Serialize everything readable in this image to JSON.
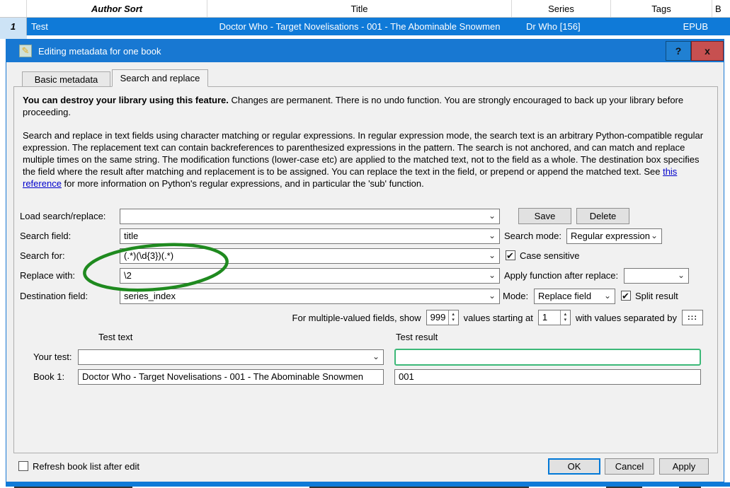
{
  "book_table": {
    "columns": [
      {
        "label": ""
      },
      {
        "label": "Author Sort"
      },
      {
        "label": "Title"
      },
      {
        "label": "Series"
      },
      {
        "label": "Tags"
      },
      {
        "label": "B"
      }
    ],
    "row": {
      "num": "1",
      "author_sort": "Test",
      "title": "Doctor Who - Target Novelisations - 001 - The Abominable Snowmen",
      "series": "Dr Who [156]",
      "format": "EPUB"
    }
  },
  "dialog": {
    "title": "Editing metadata for one book",
    "icons": {
      "pencil": "✎",
      "help": "?",
      "close": "x",
      "chevron": "⌄",
      "check": "✔",
      "spin_up": "▴",
      "spin_down": "▾"
    },
    "tabs": [
      {
        "label": "Basic metadata"
      },
      {
        "label": "Search and replace"
      }
    ],
    "warning_bold": "You can destroy your library using this feature.",
    "warning_rest": " Changes are permanent. There is no undo function. You are strongly encouraged to back up your library before proceeding.",
    "desc_part1": "Search and replace in text fields using character matching or regular expressions. In regular expression mode, the search text is an arbitrary Python-compatible regular expression. The replacement text can contain backreferences to parenthesized expressions in the pattern. The search is not anchored, and can match and replace multiple times on the same string. The modification functions (lower-case etc) are applied to the matched text, not to the field as a whole. The destination box specifies the field where the result after matching and replacement is to be assigned. You can replace the text in the field, or prepend or append the matched text. See ",
    "link_text": "this reference",
    "desc_part2": " for more information on Python's regular expressions, and in particular the 'sub' function.",
    "form": {
      "load_label": "Load search/replace:",
      "load_value": "",
      "save_button": "Save",
      "delete_button": "Delete",
      "search_field_label": "Search field:",
      "search_field_value": "title",
      "search_mode_label": "Search mode:",
      "search_mode_value": "Regular expression",
      "search_for_label": "Search for:",
      "search_for_value": "(.*)(\\d{3})(.*)",
      "case_sensitive_label": "Case sensitive",
      "case_sensitive_checked": true,
      "replace_with_label": "Replace with:",
      "replace_with_value": "\\2",
      "apply_function_label": "Apply function after replace:",
      "apply_function_value": "",
      "destination_label": "Destination field:",
      "destination_value": "series_index",
      "mode_label": "Mode:",
      "mode_value": "Replace field",
      "split_result_label": "Split result",
      "split_result_checked": true,
      "multi_text1": "For multiple-valued fields, show",
      "multi_show_value": "999",
      "multi_text2": "values starting at",
      "multi_start_value": "1",
      "multi_text3": "with values separated by",
      "separator_value": ":::"
    },
    "test": {
      "text_header": "Test text",
      "result_header": "Test result",
      "your_test_label": "Your test:",
      "your_test_value": "",
      "your_test_result": "",
      "book1_label": "Book 1:",
      "book1_value": "Doctor Who - Target Novelisations - 001 - The Abominable Snowmen",
      "book1_result": "001"
    },
    "footer": {
      "refresh_label": "Refresh book list after edit",
      "refresh_checked": false,
      "ok_button": "OK",
      "cancel_button": "Cancel",
      "apply_button": "Apply"
    }
  },
  "colors": {
    "titlebar_blue": "#1878d2",
    "selected_row_blue": "#0f7ad8",
    "close_button_red": "#c75050",
    "annotation_green": "#1f8a1f",
    "test_result_green": "#3cb878",
    "link_blue": "#0000cc"
  }
}
